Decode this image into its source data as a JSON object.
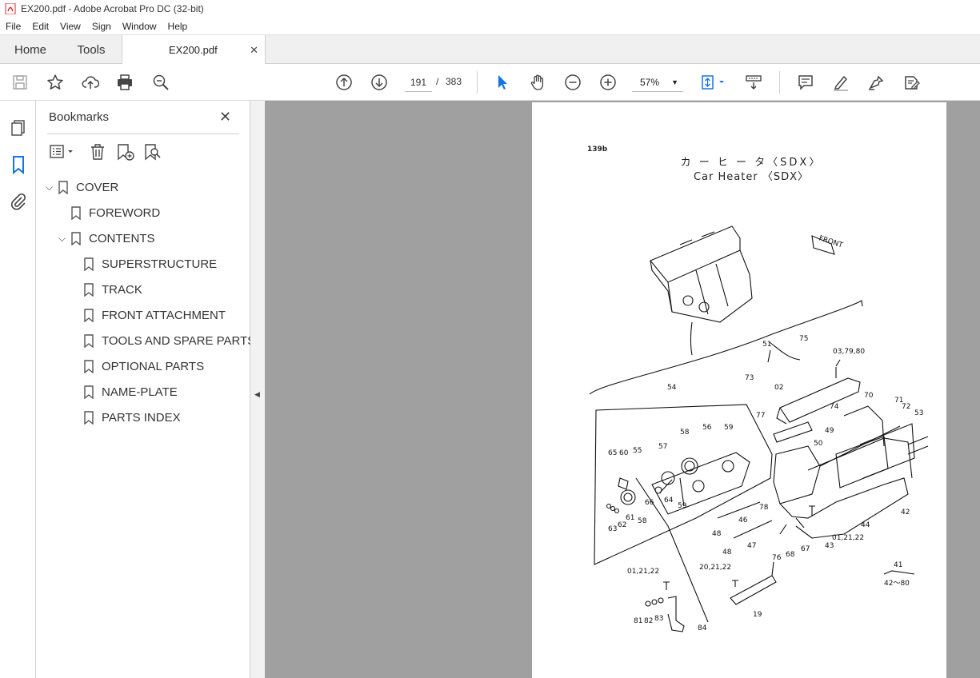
{
  "window": {
    "title": "EX200.pdf - Adobe Acrobat Pro DC (32-bit)"
  },
  "menu": [
    "File",
    "Edit",
    "View",
    "Sign",
    "Window",
    "Help"
  ],
  "tabs": {
    "home": "Home",
    "tools": "Tools",
    "document": "EX200.pdf",
    "close_glyph": "✕"
  },
  "toolbar": {
    "current_page": "191",
    "page_separator": "/",
    "total_pages": "383",
    "zoom": "57%",
    "accent": "#1473e6"
  },
  "bookmarks": {
    "title": "Bookmarks",
    "items": [
      {
        "label": "COVER",
        "level": 0,
        "expanded": true
      },
      {
        "label": "FOREWORD",
        "level": 1
      },
      {
        "label": "CONTENTS",
        "level": 1,
        "expanded": true
      },
      {
        "label": "SUPERSTRUCTURE",
        "level": 2
      },
      {
        "label": "TRACK",
        "level": 2
      },
      {
        "label": "FRONT ATTACHMENT",
        "level": 2
      },
      {
        "label": "TOOLS AND SPARE PARTS",
        "level": 2
      },
      {
        "label": "OPTIONAL PARTS",
        "level": 2
      },
      {
        "label": "NAME-PLATE",
        "level": 2
      },
      {
        "label": "PARTS INDEX",
        "level": 2
      }
    ]
  },
  "page": {
    "code": "139b",
    "title_jp": "カ ー ヒ ー タ〈SDX〉",
    "title_en": "Car Heater 〈SDX〉",
    "front_label": "FRONT",
    "callouts": [
      "54",
      "02",
      "73",
      "51",
      "75",
      "03,79,80",
      "70",
      "71",
      "72",
      "53",
      "74",
      "77",
      "49",
      "50",
      "58",
      "56",
      "59",
      "57",
      "65",
      "60",
      "55",
      "64",
      "66",
      "59",
      "58",
      "61",
      "62",
      "63",
      "46",
      "78",
      "48",
      "48",
      "47",
      "44",
      "42",
      "43",
      "01,21,22",
      "76",
      "68",
      "67",
      "01,21,22",
      "20,21,22",
      "81",
      "82",
      "83",
      "84",
      "19",
      "41",
      "42〜80"
    ]
  }
}
